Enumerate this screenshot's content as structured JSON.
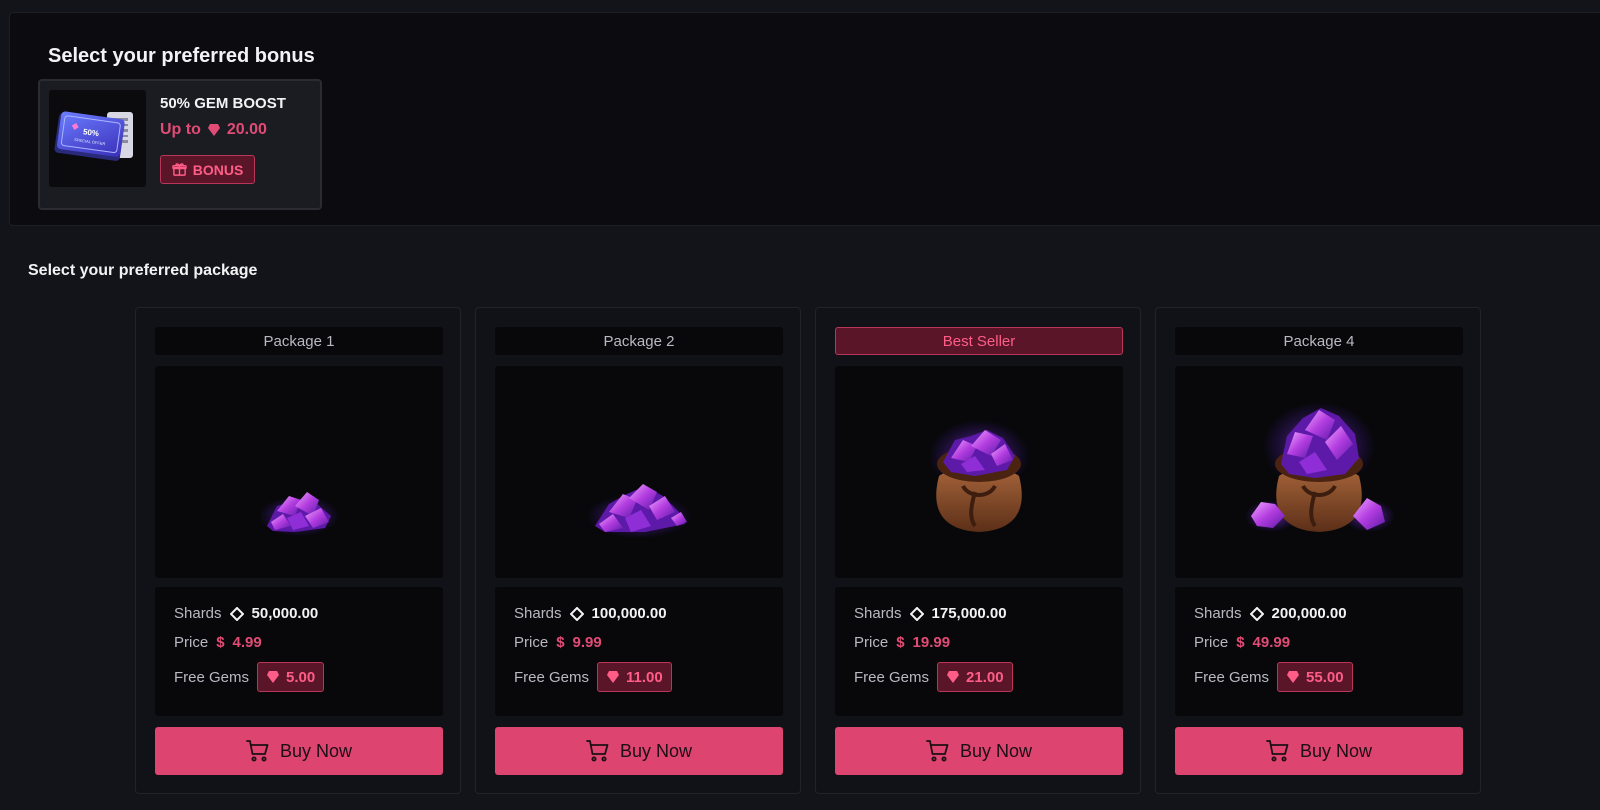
{
  "bonus": {
    "title": "Select your preferred bonus",
    "card": {
      "name": "50% GEM BOOST",
      "upto_prefix": "Up to",
      "upto_value": "20.00",
      "badge_label": "BONUS",
      "thumb_text": "50%",
      "thumb_subtext": "SPECIAL OFFER",
      "thumb_icon": "ticket-coupon-icon"
    }
  },
  "packages_section": {
    "title": "Select your preferred package",
    "labels": {
      "shards": "Shards",
      "price": "Price",
      "free_gems": "Free Gems",
      "buy": "Buy Now"
    },
    "packages": [
      {
        "label": "Package 1",
        "best": false,
        "shards": "50,000.00",
        "price": "4.99",
        "currency": "$",
        "free_gems": "5.00",
        "image": "small-gem-pile-icon"
      },
      {
        "label": "Package 2",
        "best": false,
        "shards": "100,000.00",
        "price": "9.99",
        "currency": "$",
        "free_gems": "11.00",
        "image": "gem-pile-icon"
      },
      {
        "label": "Best Seller",
        "best": true,
        "shards": "175,000.00",
        "price": "19.99",
        "currency": "$",
        "free_gems": "21.00",
        "image": "gem-bag-icon"
      },
      {
        "label": "Package 4",
        "best": false,
        "shards": "200,000.00",
        "price": "49.99",
        "currency": "$",
        "free_gems": "55.00",
        "image": "large-gem-bag-icon"
      }
    ]
  },
  "colors": {
    "accent": "#dd4470",
    "accent_text": "#e14b76",
    "badge_bg": "#5a1628",
    "badge_border": "#b83658",
    "panel_bg": "#0c0c10",
    "page_bg": "#131419"
  }
}
